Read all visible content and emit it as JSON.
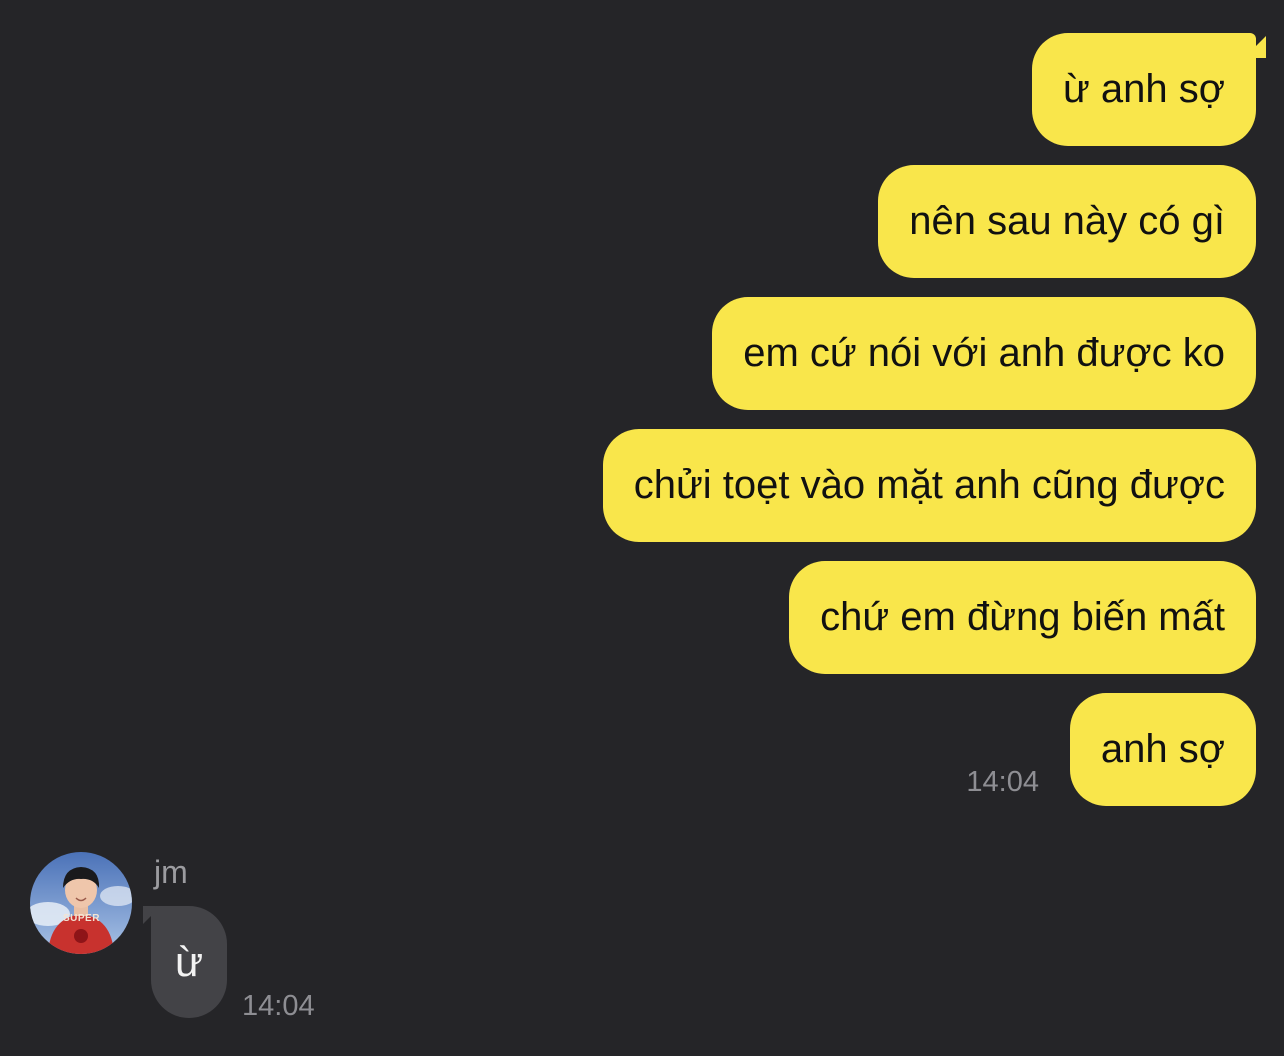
{
  "outgoing": {
    "messages": [
      "ừ anh sợ",
      "nên sau này có gì",
      "em cứ nói với anh được ko",
      "chửi toẹt vào mặt anh cũng được",
      "chứ em đừng biến mất",
      "anh sợ"
    ],
    "time": "14:04"
  },
  "incoming": {
    "sender": "jm",
    "avatar_shirt_text": "SUPER",
    "message": "ừ",
    "time": "14:04"
  },
  "colors": {
    "background": "#252528",
    "outgoing_bubble": "#f9e64b",
    "incoming_bubble": "#434347",
    "timestamp": "#8e8e93"
  }
}
